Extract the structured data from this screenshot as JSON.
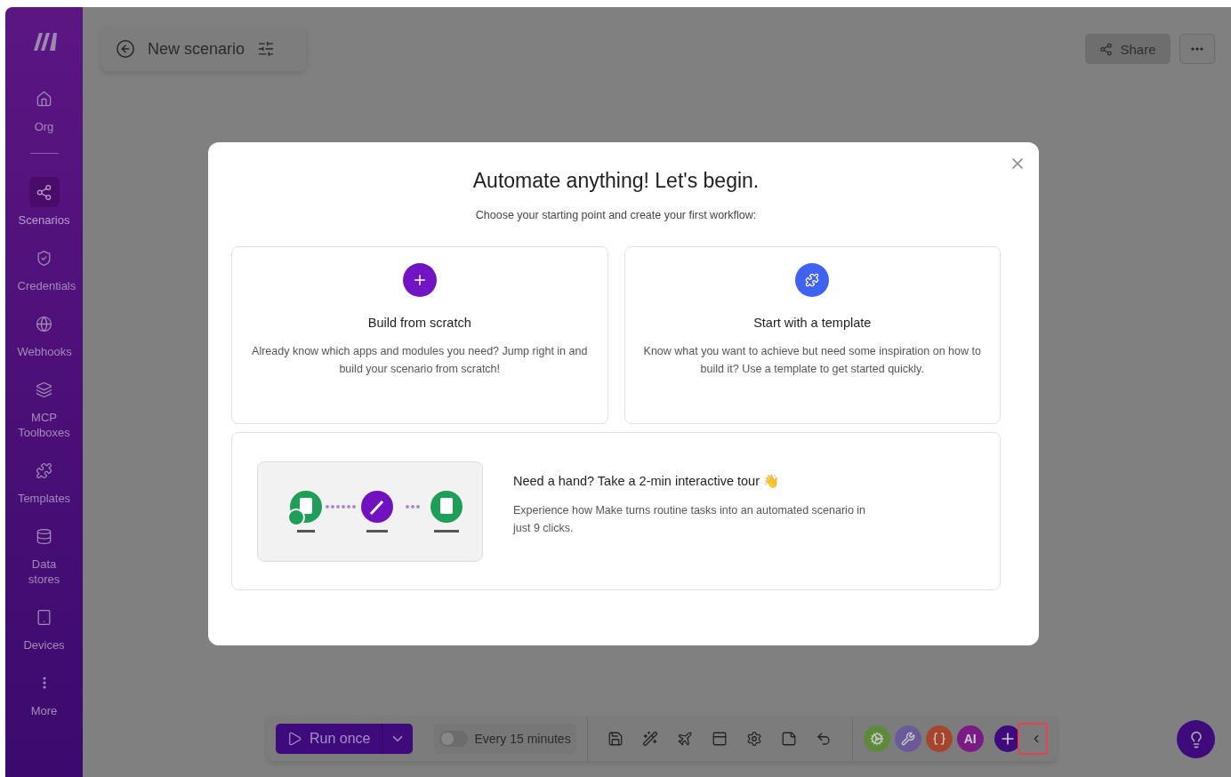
{
  "sidebar": {
    "items": [
      {
        "label": "Org",
        "selected": false
      },
      {
        "label": "Scenarios",
        "selected": true
      },
      {
        "label": "Credentials",
        "selected": false
      },
      {
        "label": "Webhooks",
        "selected": false
      },
      {
        "label": "MCP Toolboxes",
        "selected": false
      },
      {
        "label": "Templates",
        "selected": false
      },
      {
        "label": "Data stores",
        "selected": false
      },
      {
        "label": "Devices",
        "selected": false
      },
      {
        "label": "More",
        "selected": false
      }
    ]
  },
  "scenario": {
    "title": "New scenario"
  },
  "top_actions": {
    "share": "Share"
  },
  "modal": {
    "title": "Automate anything! Let's begin.",
    "subtitle": "Choose your starting point and create your first workflow:",
    "options": [
      {
        "kind": "scratch",
        "title": "Build from scratch",
        "description": "Already know which apps and modules you need? Jump right in and build your scenario from scratch!"
      },
      {
        "kind": "template",
        "title": "Start with a template",
        "description": "Know what you want to achieve but need some inspiration on how to build it? Use a template to get started quickly."
      }
    ],
    "tour": {
      "title": "Need a hand? Take a 2-min interactive tour 👋",
      "description": "Experience how Make turns routine tasks into an automated scenario in just 9 clicks."
    }
  },
  "toolbar": {
    "run": "Run once",
    "schedule": {
      "on": false,
      "label": "Every 15 minutes"
    },
    "apps": [
      {
        "kind": "icon",
        "color": "#5e8a3c"
      },
      {
        "kind": "icon",
        "color": "#6b5a9a"
      },
      {
        "kind": "icon",
        "color": "#a6452d"
      },
      {
        "kind": "text",
        "label": "AI",
        "color": "#7a1a86"
      }
    ],
    "collapse_highlighted": true
  }
}
